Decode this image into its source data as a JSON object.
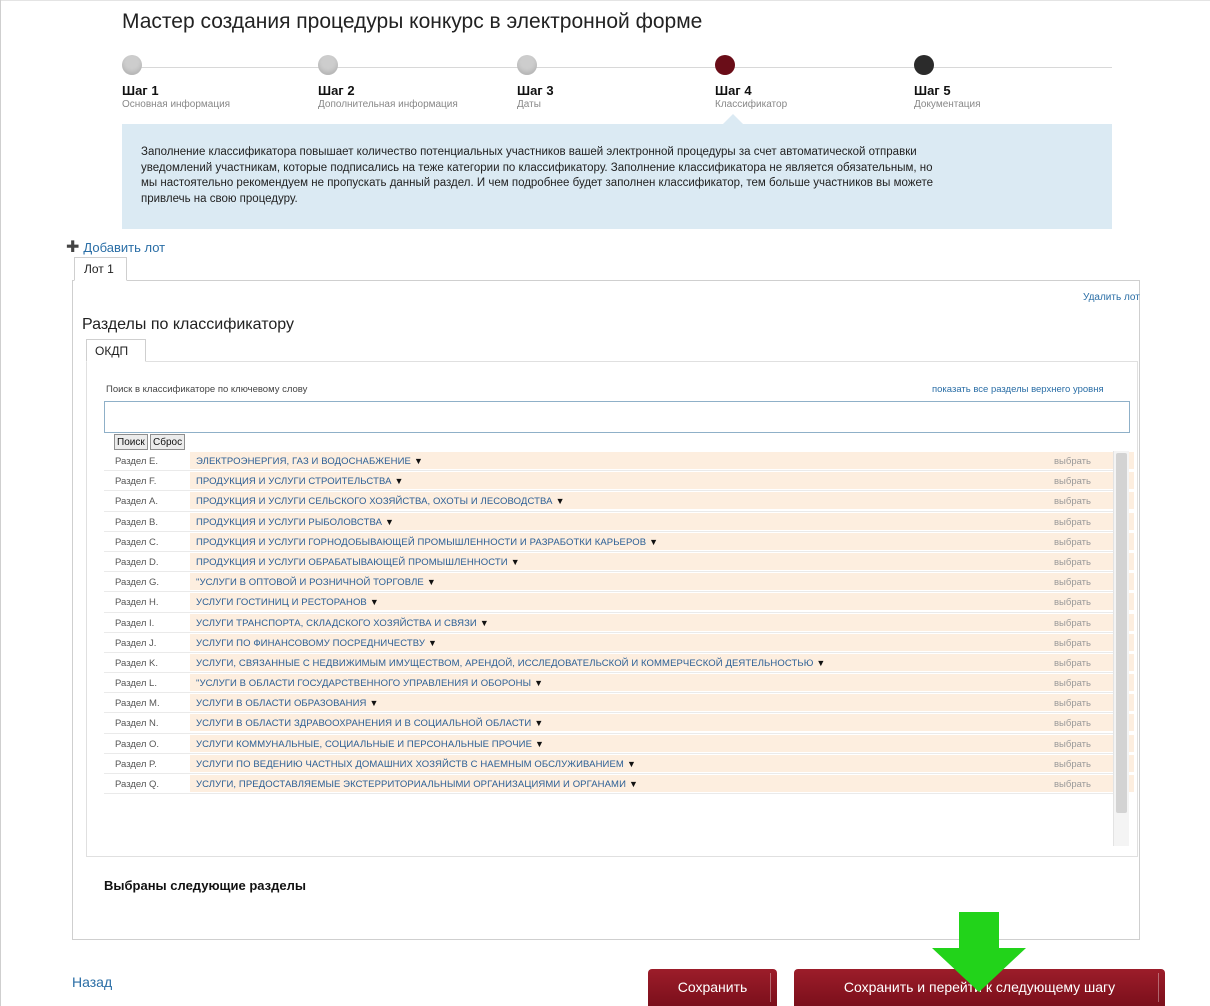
{
  "wizard": {
    "title": "Мастер создания процедуры конкурс в электронной форме",
    "steps": [
      {
        "title": "Шаг 1",
        "subtitle": "Основная информация",
        "state": "done"
      },
      {
        "title": "Шаг 2",
        "subtitle": "Дополнительная информация",
        "state": "done"
      },
      {
        "title": "Шаг 3",
        "subtitle": "Даты",
        "state": "done"
      },
      {
        "title": "Шаг 4",
        "subtitle": "Классификатор",
        "state": "active"
      },
      {
        "title": "Шаг 5",
        "subtitle": "Документация",
        "state": "pending"
      }
    ],
    "info_lines": [
      "Заполнение классификатора повышает количество потенциальных участников вашей электронной процедуры за счет автоматической отправки",
      "уведомлений участникам, которые подписались на теже категории по классификатору. Заполнение классификатора не является обязательным, но",
      "мы настоятельно рекомендуем не пропускать данный раздел. И чем подробнее будет заполнен классификатор, тем больше участников вы можете",
      "привлечь на свою процедуру."
    ]
  },
  "lots": {
    "add_label": "Добавить лот",
    "tab_label": "Лот 1",
    "delete_label": "Удалить лот"
  },
  "classifier": {
    "title": "Разделы по классификатору",
    "tab_label": "ОКДП",
    "search_label": "Поиск в классификаторе по ключевому слову",
    "show_all_label": "показать все разделы верхнего уровня",
    "search_value": "",
    "search_button": "Поиск",
    "reset_button": "Сброс",
    "choose_label": "выбрать",
    "sections": [
      {
        "code": "Раздел E.",
        "name": "ЭЛЕКТРОЭНЕРГИЯ, ГАЗ И ВОДОСНАБЖЕНИЕ"
      },
      {
        "code": "Раздел F.",
        "name": "ПРОДУКЦИЯ И УСЛУГИ СТРОИТЕЛЬСТВА"
      },
      {
        "code": "Раздел A.",
        "name": "ПРОДУКЦИЯ И УСЛУГИ СЕЛЬСКОГО ХОЗЯЙСТВА, ОХОТЫ И ЛЕСОВОДСТВА"
      },
      {
        "code": "Раздел B.",
        "name": "ПРОДУКЦИЯ И УСЛУГИ РЫБОЛОВСТВА"
      },
      {
        "code": "Раздел C.",
        "name": "ПРОДУКЦИЯ И УСЛУГИ ГОРНОДОБЫВАЮЩЕЙ ПРОМЫШЛЕННОСТИ И РАЗРАБОТКИ КАРЬЕРОВ"
      },
      {
        "code": "Раздел D.",
        "name": "ПРОДУКЦИЯ И УСЛУГИ ОБРАБАТЫВАЮЩЕЙ ПРОМЫШЛЕННОСТИ"
      },
      {
        "code": "Раздел G.",
        "name": "\"УСЛУГИ В ОПТОВОЙ И РОЗНИЧНОЙ ТОРГОВЛЕ"
      },
      {
        "code": "Раздел H.",
        "name": "УСЛУГИ ГОСТИНИЦ И РЕСТОРАНОВ"
      },
      {
        "code": "Раздел I.",
        "name": "УСЛУГИ ТРАНСПОРТА, СКЛАДСКОГО ХОЗЯЙСТВА И СВЯЗИ"
      },
      {
        "code": "Раздел J.",
        "name": "УСЛУГИ ПО ФИНАНСОВОМУ ПОСРЕДНИЧЕСТВУ"
      },
      {
        "code": "Раздел K.",
        "name": "УСЛУГИ, СВЯЗАННЫЕ С НЕДВИЖИМЫМ ИМУЩЕСТВОМ, АРЕНДОЙ, ИССЛЕДОВАТЕЛЬСКОЙ И КОММЕРЧЕСКОЙ ДЕЯТЕЛЬНОСТЬЮ"
      },
      {
        "code": "Раздел L.",
        "name": "\"УСЛУГИ В ОБЛАСТИ ГОСУДАРСТВЕННОГО УПРАВЛЕНИЯ И ОБОРОНЫ"
      },
      {
        "code": "Раздел M.",
        "name": "УСЛУГИ В ОБЛАСТИ ОБРАЗОВАНИЯ"
      },
      {
        "code": "Раздел N.",
        "name": "УСЛУГИ В ОБЛАСТИ ЗДРАВООХРАНЕНИЯ И В СОЦИАЛЬНОЙ ОБЛАСТИ"
      },
      {
        "code": "Раздел O.",
        "name": "УСЛУГИ КОММУНАЛЬНЫЕ, СОЦИАЛЬНЫЕ И ПЕРСОНАЛЬНЫЕ ПРОЧИЕ"
      },
      {
        "code": "Раздел P.",
        "name": "УСЛУГИ ПО ВЕДЕНИЮ ЧАСТНЫХ ДОМАШНИХ ХОЗЯЙСТВ С НАЕМНЫМ ОБСЛУЖИВАНИЕМ"
      },
      {
        "code": "Раздел Q.",
        "name": "УСЛУГИ, ПРЕДОСТАВЛЯЕМЫЕ ЭКСТЕРРИТОРИАЛЬНЫМИ ОРГАНИЗАЦИЯМИ И ОРГАНАМИ"
      }
    ],
    "selected_title": "Выбраны следующие разделы"
  },
  "footer": {
    "back_label": "Назад",
    "save_label": "Сохранить",
    "save_next_label": "Сохранить и перейти к следующему шагу"
  },
  "colors": {
    "accent": "#7b0f1b",
    "link": "#2a6ea6",
    "info_bg": "#dbeaf3",
    "row_bg": "#fdeedf",
    "arrow": "#22d31a"
  }
}
